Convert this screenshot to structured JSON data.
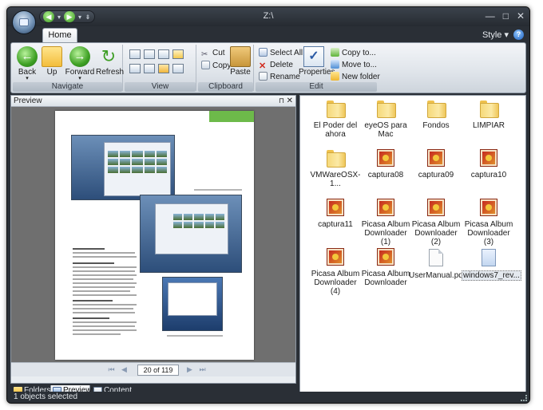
{
  "window": {
    "title": "Z:\\",
    "controls": {
      "minimize": "—",
      "maximize": "□",
      "close": "✕"
    }
  },
  "quick_access": {
    "back": "◀",
    "forward": "▶",
    "dropdown": "▾",
    "customize": "⇟"
  },
  "ribbon": {
    "tabs": [
      {
        "label": "Home",
        "active": true
      }
    ],
    "style_label": "Style",
    "style_arrow": "▾",
    "help_glyph": "?",
    "groups": {
      "navigate": {
        "label": "Navigate",
        "buttons": {
          "back": "Back",
          "up": "Up",
          "forward": "Forward",
          "refresh": "Refresh"
        }
      },
      "view": {
        "label": "View"
      },
      "clipboard": {
        "label": "Clipboard",
        "buttons": {
          "cut": "Cut",
          "copy": "Copy",
          "paste": "Paste"
        }
      },
      "edit": {
        "label": "Edit",
        "buttons": {
          "select_all": "Select All",
          "delete": "Delete",
          "rename": "Rename",
          "properties": "Properties",
          "copy_to": "Copy to...",
          "move_to": "Move to...",
          "new_folder": "New folder"
        }
      }
    }
  },
  "preview": {
    "title": "Preview",
    "pin_glyph": "⊓",
    "close_glyph": "✕",
    "page_indicator": "20 of 119",
    "nav": {
      "first": "⏮",
      "prev": "◀",
      "next": "▶",
      "last": "⏭"
    }
  },
  "bottom_tabs": [
    {
      "label": "Folders",
      "active": false
    },
    {
      "label": "Preview",
      "active": true
    },
    {
      "label": "Content",
      "active": false
    }
  ],
  "files": [
    {
      "name": "El Poder del ahora",
      "type": "folder",
      "icon": "folder-icon"
    },
    {
      "name": "eyeOS para Mac",
      "type": "folder",
      "icon": "folder-icon"
    },
    {
      "name": "Fondos",
      "type": "folder",
      "icon": "folder-icon"
    },
    {
      "name": "LIMPIAR",
      "type": "folder",
      "icon": "folder-icon"
    },
    {
      "name": "VMWareOSX-1...",
      "type": "folder",
      "icon": "folder-icon"
    },
    {
      "name": "captura08",
      "type": "image",
      "icon": "image-file-icon"
    },
    {
      "name": "captura09",
      "type": "image",
      "icon": "image-file-icon"
    },
    {
      "name": "captura10",
      "type": "image",
      "icon": "image-file-icon"
    },
    {
      "name": "captura11",
      "type": "image",
      "icon": "image-file-icon"
    },
    {
      "name": "Picasa Album Downloader (1)",
      "type": "image",
      "icon": "image-file-icon"
    },
    {
      "name": "Picasa Album Downloader (2)",
      "type": "image",
      "icon": "image-file-icon"
    },
    {
      "name": "Picasa Album Downloader (3)",
      "type": "image",
      "icon": "image-file-icon"
    },
    {
      "name": "Picasa Album Downloader (4)",
      "type": "image",
      "icon": "image-file-icon"
    },
    {
      "name": "Picasa Album Downloader",
      "type": "image",
      "icon": "image-file-icon"
    },
    {
      "name": "UserManual.pdf",
      "type": "pdf",
      "icon": "pdf-file-icon"
    },
    {
      "name": "windows7_rev...",
      "type": "document",
      "icon": "document-file-icon",
      "selected": true
    }
  ],
  "status": {
    "text": "1 objects selected"
  }
}
